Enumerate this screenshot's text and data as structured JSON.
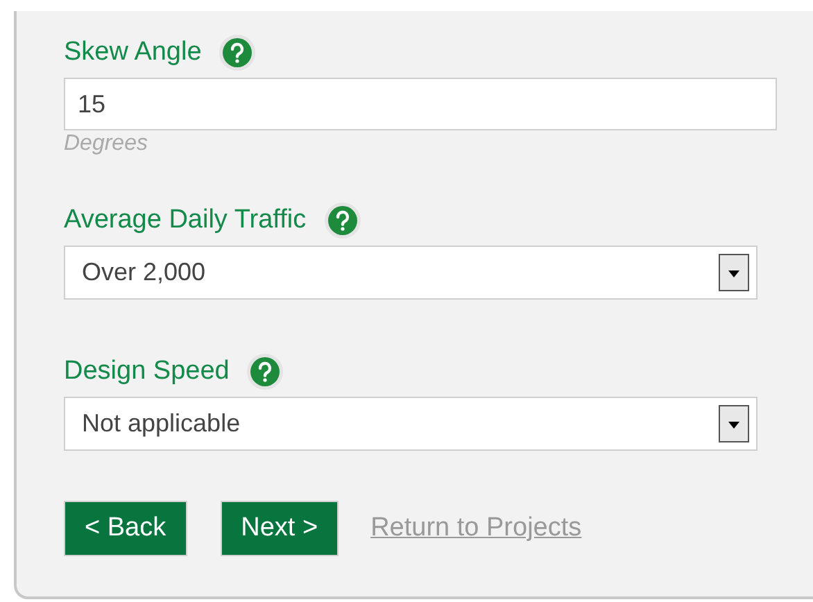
{
  "fields": [
    {
      "kind": "text",
      "label": "Skew Angle",
      "value": "15",
      "hint": "Degrees"
    },
    {
      "kind": "select",
      "label": "Average Daily Traffic",
      "value": "Over 2,000"
    },
    {
      "kind": "select",
      "label": "Design Speed",
      "value": "Not applicable"
    }
  ],
  "buttons": [
    "< Back",
    "Next >"
  ],
  "link": "Return to Projects"
}
